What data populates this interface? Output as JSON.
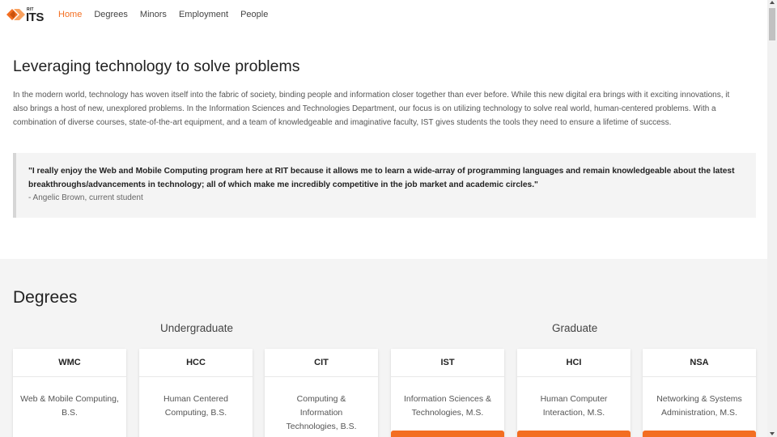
{
  "nav": {
    "logo_small": "RIT",
    "logo_text": "ITS",
    "logo_icon": "orange-diamond-arrows-logo",
    "accent_color": "#f36e21",
    "links": [
      {
        "label": "Home",
        "active": true
      },
      {
        "label": "Degrees",
        "active": false
      },
      {
        "label": "Minors",
        "active": false
      },
      {
        "label": "Employment",
        "active": false
      },
      {
        "label": "People",
        "active": false
      }
    ]
  },
  "about": {
    "title": "Leveraging technology to solve problems",
    "description": "In the modern world, technology has woven itself into the fabric of society, binding people and information closer together than ever before. While this new digital era brings with it exciting innovations, it also brings a host of new, unexplored problems. In the Information Sciences and Technologies Department, our focus is on utilizing technology to solve real world, human-centered problems. With a combination of diverse courses, state-of-the-art equipment, and a team of knowledgeable and imaginative faculty, IST gives students the tools they need to ensure a lifetime of success.",
    "quote": "\"I really enjoy the Web and Mobile Computing program here at RIT because it allows me to learn a wide-array of programming languages and remain knowledgeable about the latest breakthroughs/advancements in technology; all of which make me incredibly competitive in the job market and academic circles.\"",
    "quote_author": "- Angelic Brown, current student"
  },
  "degrees": {
    "title": "Degrees",
    "undergraduate_label": "Undergraduate",
    "graduate_label": "Graduate",
    "cards": [
      {
        "abbr": "WMC",
        "name": "Web & Mobile Computing, B.S.",
        "level": "undergraduate"
      },
      {
        "abbr": "HCC",
        "name": "Human Centered Computing, B.S.",
        "level": "undergraduate"
      },
      {
        "abbr": "CIT",
        "name": "Computing & Information Technologies, B.S.",
        "level": "undergraduate"
      },
      {
        "abbr": "IST",
        "name": "Information Sciences & Technologies, M.S.",
        "level": "graduate"
      },
      {
        "abbr": "HCI",
        "name": "Human Computer Interaction, M.S.",
        "level": "graduate"
      },
      {
        "abbr": "NSA",
        "name": "Networking & Systems Administration, M.S.",
        "level": "graduate"
      }
    ]
  }
}
